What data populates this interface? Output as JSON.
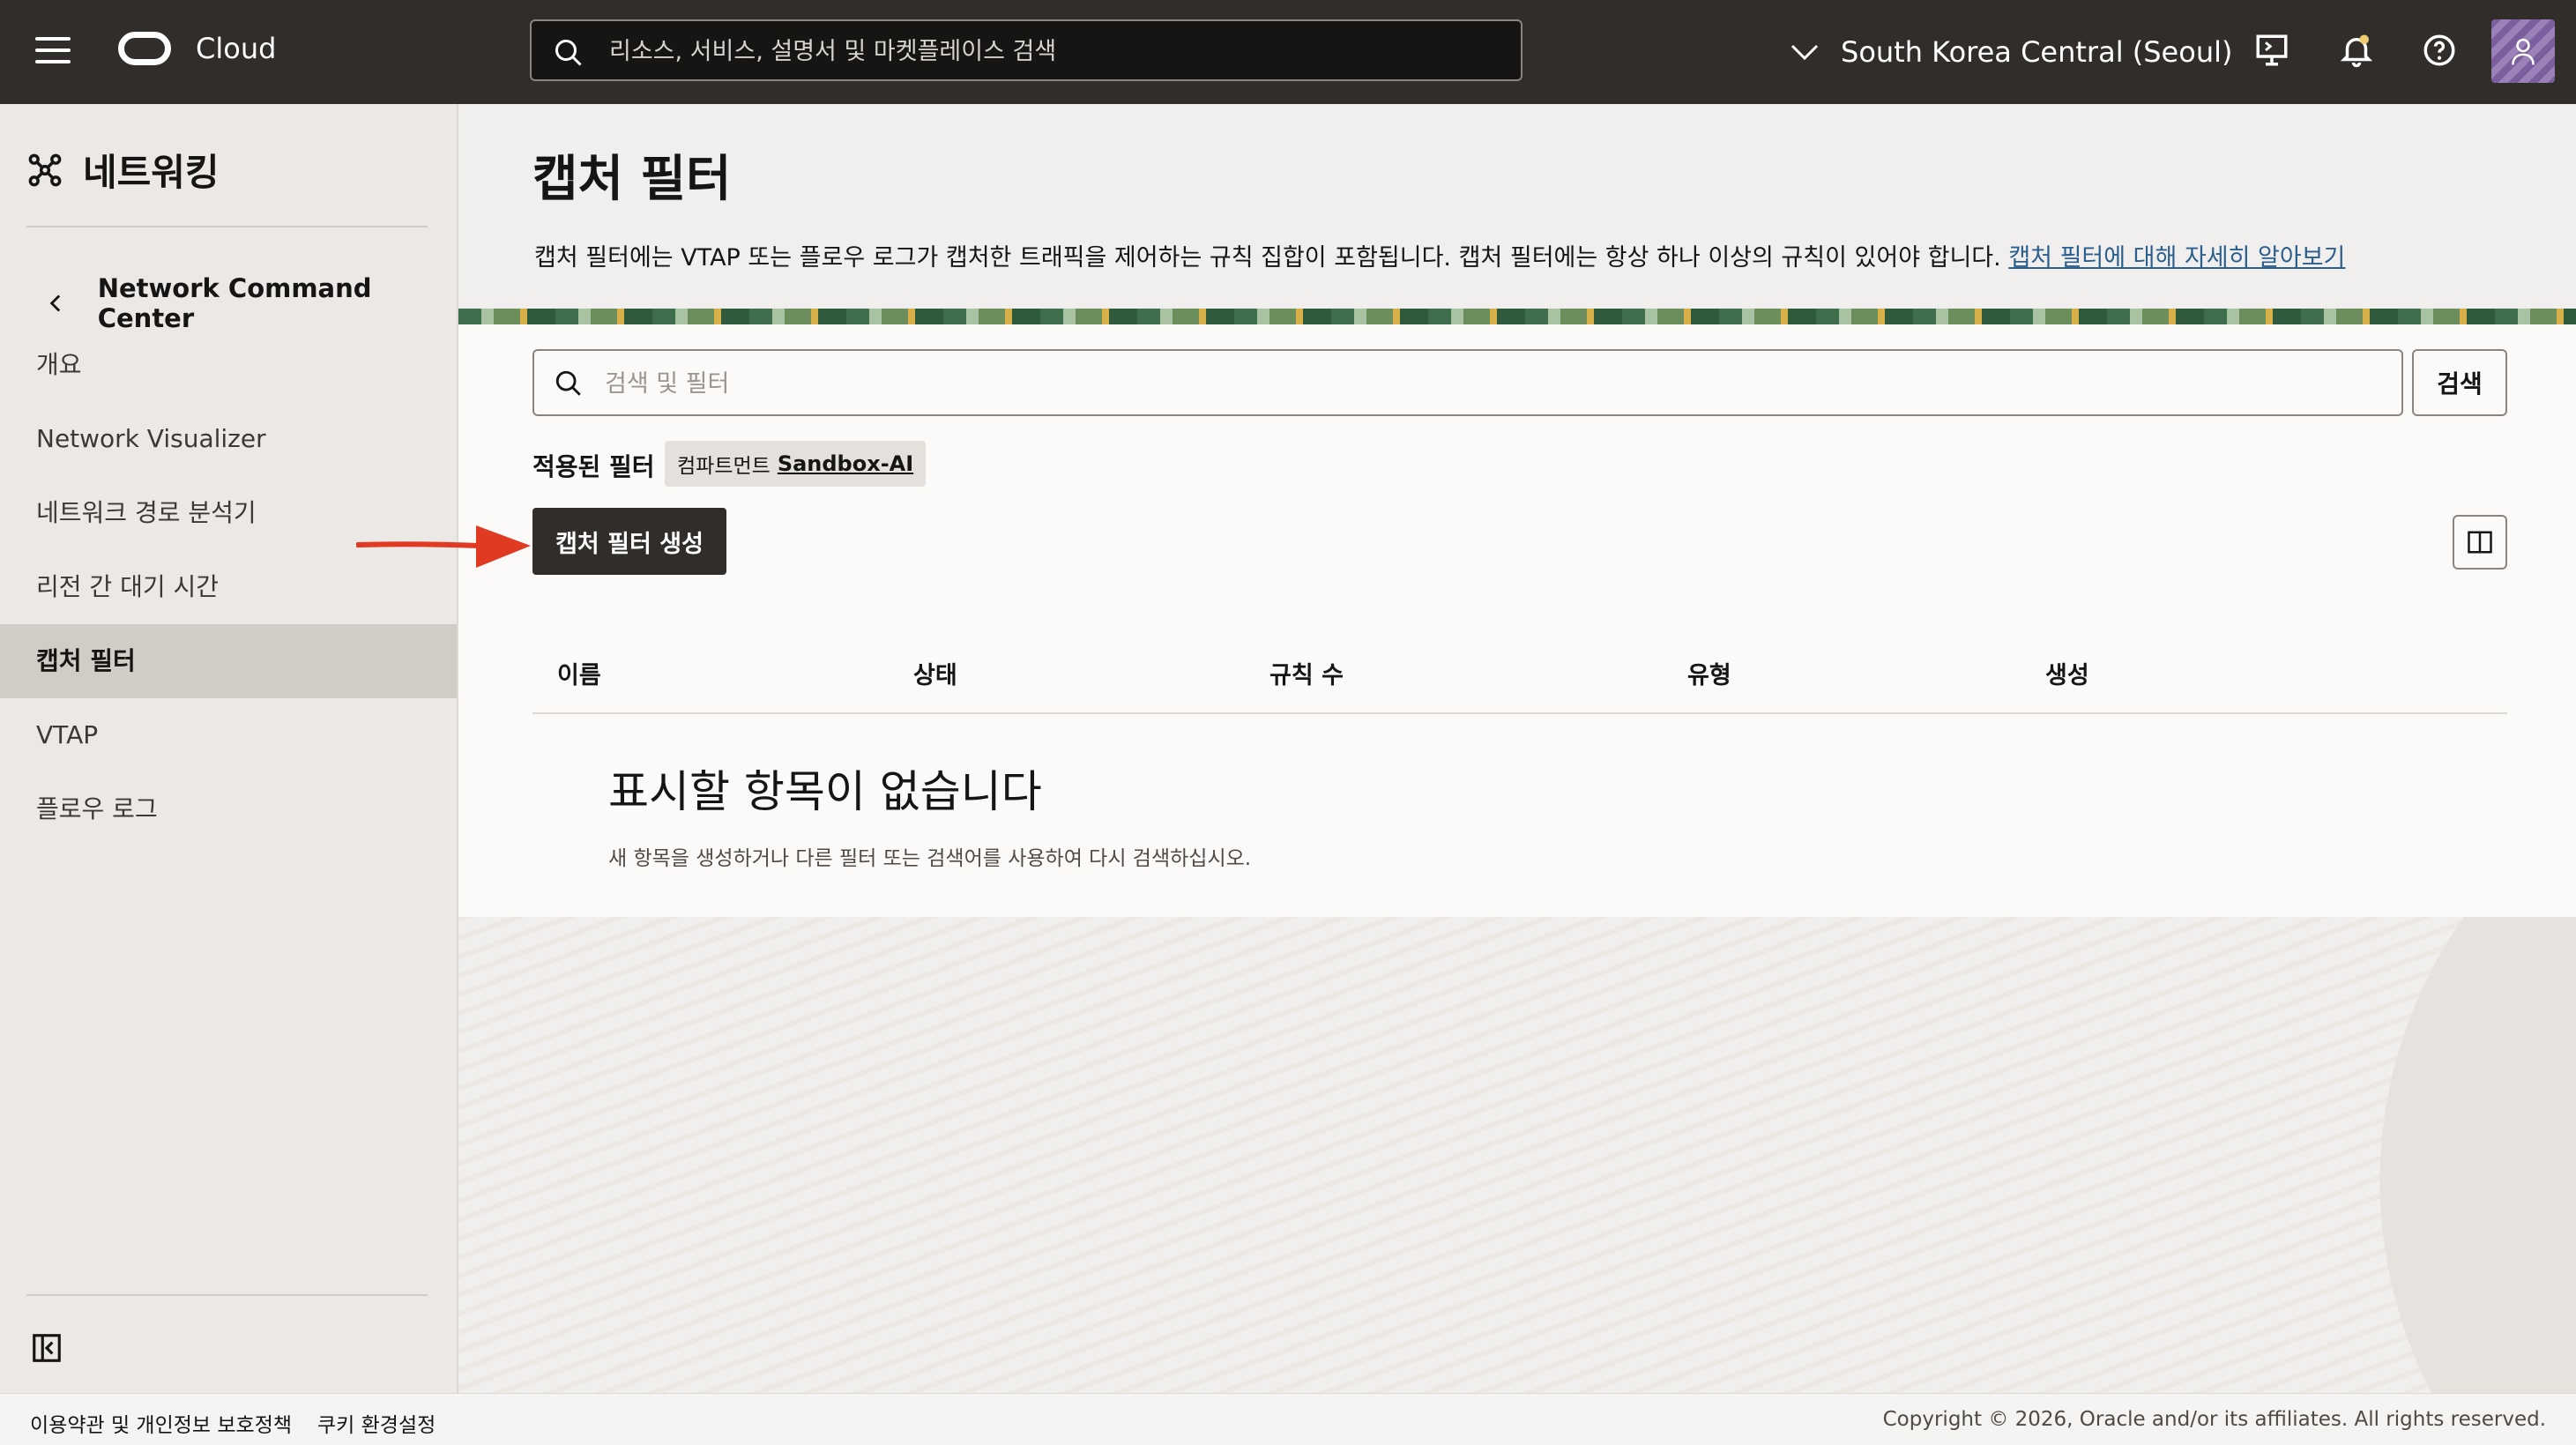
{
  "topbar": {
    "brand": "Cloud",
    "search_placeholder": "리소스, 서비스, 설명서 및 마켓플레이스 검색",
    "region": "South Korea Central (Seoul)"
  },
  "sidebar": {
    "title": "네트워킹",
    "back_label": "Network Command Center",
    "items": [
      {
        "label": "개요"
      },
      {
        "label": "Network Visualizer"
      },
      {
        "label": "네트워크 경로 분석기"
      },
      {
        "label": "리전 간 대기 시간"
      },
      {
        "label": "캡처 필터"
      },
      {
        "label": "VTAP"
      },
      {
        "label": "플로우 로그"
      }
    ]
  },
  "main": {
    "title": "캡처 필터",
    "description": "캡처 필터에는 VTAP 또는 플로우 로그가 캡처한 트래픽을 제어하는 규칙 집합이 포함됩니다. 캡처 필터에는 항상 하나 이상의 규칙이 있어야 합니다. ",
    "learn_more": "캡처 필터에 대해 자세히 알아보기",
    "filter_placeholder": "검색 및 필터",
    "search_button": "검색",
    "applied_filters_label": "적용된 필터",
    "chip_key": "컴파트먼트",
    "chip_value": "Sandbox-AI",
    "create_button": "캡처 필터 생성",
    "columns": [
      "이름",
      "상태",
      "규칙 수",
      "유형",
      "생성"
    ],
    "empty_title": "표시할 항목이 없습니다",
    "empty_desc": "새 항목을 생성하거나 다른 필터 또는 검색어를 사용하여 다시 검색하십시오."
  },
  "footer": {
    "terms": "이용약관 및 개인정보 보호정책",
    "cookies": "쿠키 환경설정",
    "copyright": "Copyright © 2026, Oracle and/or its affiliates. All rights reserved."
  },
  "colors": {
    "topbar": "#312d2a",
    "accent_link": "#2b5f8e",
    "annotation_arrow": "#e03a22"
  }
}
